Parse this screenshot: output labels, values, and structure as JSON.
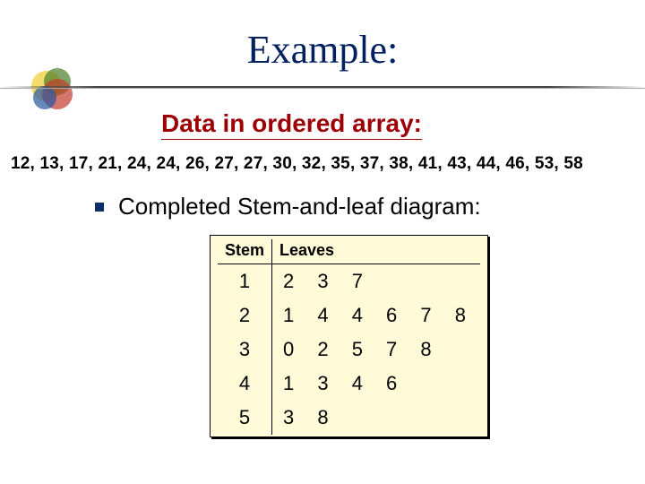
{
  "title": "Example:",
  "ordered_label": "Data in ordered array:",
  "ordered_array": "12, 13, 17, 21, 24, 24, 26, 27, 27, 30, 32, 35, 37, 38, 41, 43, 44, 46, 53, 58",
  "bullet_text": "Completed Stem-and-leaf diagram:",
  "table": {
    "stem_header": "Stem",
    "leaves_header": "Leaves",
    "rows": [
      {
        "stem": "1",
        "leaves": "2 3 7"
      },
      {
        "stem": "2",
        "leaves": "1 4 4 6 7 8"
      },
      {
        "stem": "3",
        "leaves": "0 2 5 7 8"
      },
      {
        "stem": "4",
        "leaves": "1 3 4 6"
      },
      {
        "stem": "5",
        "leaves": "3 8"
      }
    ]
  }
}
